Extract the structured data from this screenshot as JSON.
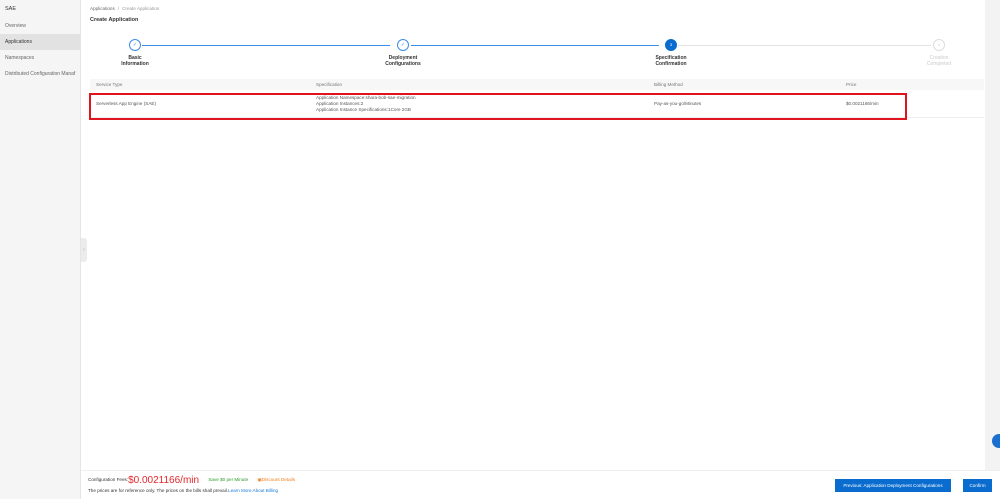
{
  "sidebar": {
    "title": "SAE",
    "items": [
      {
        "label": "Overview"
      },
      {
        "label": "Applications",
        "active": true
      },
      {
        "label": "Namespaces"
      },
      {
        "label": "Distributed Configuration Manaf"
      }
    ]
  },
  "breadcrumb": {
    "root": "Applications",
    "sep": "/",
    "current": "Create Application"
  },
  "page_title": "Create Application",
  "steps": [
    {
      "label1": "Basic",
      "label2": "Information",
      "icon": "check-icon",
      "status": "done"
    },
    {
      "label1": "Deployment",
      "label2": "Configurations",
      "icon": "check-icon",
      "status": "done"
    },
    {
      "num": "3",
      "label1": "Specification",
      "label2": "Confirmation",
      "status": "current"
    },
    {
      "num": "4",
      "label1": "Creation",
      "label2": "Completed",
      "status": "todo"
    }
  ],
  "table": {
    "headers": [
      "Service Type",
      "Specification",
      "Billing Method",
      "Price"
    ],
    "row": {
      "service": "Serverless App Engine (SAE)",
      "spec": [
        "Application Namespace:shara-bob-sae-migration",
        "Application Instances:2",
        "Application Instance Specifications:1Core 2GB"
      ],
      "billing": "Pay-as-you-go/Minutes",
      "price": "$0.0021166/min"
    }
  },
  "footer": {
    "fee_label": "Configuration Fees:",
    "fee_amount": "$0.0021166/min",
    "save": "Save $0 per Minute",
    "discount": "Discount Details",
    "note": "The prices are for reference only. The prices on the bills shall prevail.",
    "learn_more": "Learn More About Billing"
  },
  "buttons": {
    "previous": "Previous: Application Deployment Configurations",
    "confirm": "Confirm"
  },
  "colors": {
    "primary": "#0a6ccf",
    "highlight": "#e0141e",
    "price": "#e5262b"
  }
}
